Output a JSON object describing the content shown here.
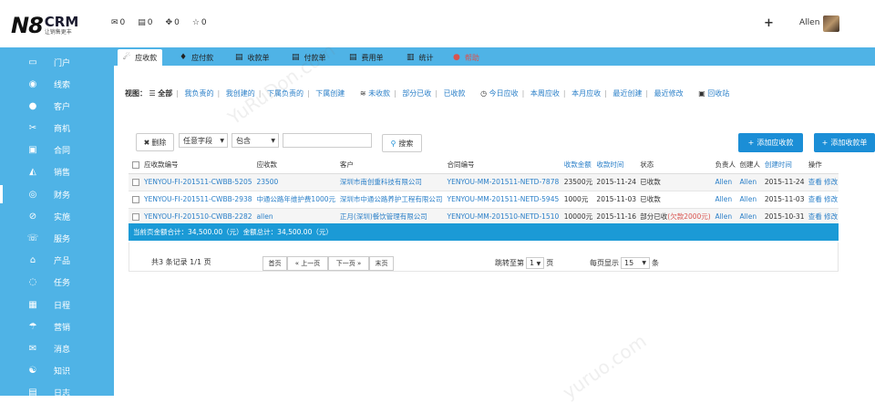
{
  "header": {
    "logo_main": "N8",
    "logo_crm": "CRM",
    "logo_sub": "让销售更丰",
    "mail_count": "0",
    "msg_count": "0",
    "share_count": "0",
    "star_count": "0",
    "plus": "+",
    "username": "Allen"
  },
  "sidebar": {
    "items": [
      {
        "label": "门户",
        "icon": "▭"
      },
      {
        "label": "线索",
        "icon": "◉"
      },
      {
        "label": "客户",
        "icon": "●"
      },
      {
        "label": "商机",
        "icon": "✂"
      },
      {
        "label": "合同",
        "icon": "▣"
      },
      {
        "label": "销售",
        "icon": "◭"
      },
      {
        "label": "财务",
        "icon": "◎"
      },
      {
        "label": "实施",
        "icon": "⊘"
      },
      {
        "label": "服务",
        "icon": "☏"
      },
      {
        "label": "产品",
        "icon": "⌂"
      },
      {
        "label": "任务",
        "icon": "◌"
      },
      {
        "label": "日程",
        "icon": "▦"
      },
      {
        "label": "营销",
        "icon": "☂"
      },
      {
        "label": "消息",
        "icon": "✉"
      },
      {
        "label": "知识",
        "icon": "☯"
      },
      {
        "label": "日志",
        "icon": "▤"
      }
    ]
  },
  "tabs": [
    {
      "label": "应收款",
      "icon": "☄"
    },
    {
      "label": "应付款",
      "icon": "♦"
    },
    {
      "label": "收款单",
      "icon": "▤"
    },
    {
      "label": "付款单",
      "icon": "▤"
    },
    {
      "label": "费用单",
      "icon": "▤"
    },
    {
      "label": "统计",
      "icon": "▥"
    },
    {
      "label": "帮助",
      "icon": "●"
    }
  ],
  "viewbar": {
    "label": "视图：",
    "all": "全部",
    "mine": "我负责的",
    "created": "我创建的",
    "sub_resp": "下属负责的",
    "sub_created": "下属创建",
    "unpaid": "未收款",
    "partial": "部分已收",
    "paid": "已收款",
    "today": "今日应收",
    "week": "本周应收",
    "month": "本月应收",
    "recent_created": "最近创建",
    "recent_modified": "最近修改",
    "recycle": "回收站"
  },
  "toolbar": {
    "delete": "删除",
    "field": "任意字段",
    "cond": "包含",
    "search": "搜索",
    "add_receivable": "添加应收款",
    "add_receipt": "添加收款单"
  },
  "table": {
    "headers": [
      "应收款编号",
      "应收款",
      "客户",
      "合同编号",
      "收款金额",
      "收款时间",
      "状态",
      "负责人",
      "创建人",
      "创建时间",
      "操作"
    ],
    "rows": [
      {
        "id": "YENYOU-FI-201511-CWBB-5205",
        "name": "23500",
        "customer": "深圳市南创重科技有限公司",
        "contract": "YENYOU-MM-201511-NETD-7878",
        "amount": "23500元",
        "date": "2015-11-24",
        "status": "已收款",
        "status_extra": "",
        "owner": "Allen",
        "creator": "Allen",
        "created": "2015-11-24",
        "view": "查看",
        "edit": "修改"
      },
      {
        "id": "YENYOU-FI-201511-CWBB-2938",
        "name": "中通公路年维护费1000元",
        "customer": "深圳市中通公路养护工程有限公司",
        "contract": "YENYOU-MM-201511-NETD-5945",
        "amount": "1000元",
        "date": "2015-11-03",
        "status": "已收款",
        "status_extra": "",
        "owner": "Allen",
        "creator": "Allen",
        "created": "2015-11-03",
        "view": "查看",
        "edit": "修改"
      },
      {
        "id": "YENYOU-FI-201510-CWBB-2282",
        "name": "allen",
        "customer": "正月(深圳)餐饮管理有限公司",
        "contract": "YENYOU-MM-201510-NETD-1510",
        "amount": "10000元",
        "date": "2015-11-16",
        "status": "部分已收",
        "status_extra": "(欠款2000元)",
        "owner": "Allen",
        "creator": "Allen",
        "created": "2015-10-31",
        "view": "查看",
        "edit": "修改"
      }
    ],
    "summary": "当前页金额合计：34,500.00（元）金额总计：34,500.00（元）"
  },
  "pager": {
    "info": "共3 条记录 1/1 页",
    "first": "首页",
    "prev": "« 上一页",
    "next": "下一页 »",
    "last": "末页",
    "jump_label": "跳转至第",
    "jump_value": "1",
    "jump_unit": "页",
    "per_label": "每页显示",
    "per_value": "15",
    "per_unit": "条"
  },
  "watermarks": [
    "YuRuDon.com",
    "yuruo.com"
  ]
}
